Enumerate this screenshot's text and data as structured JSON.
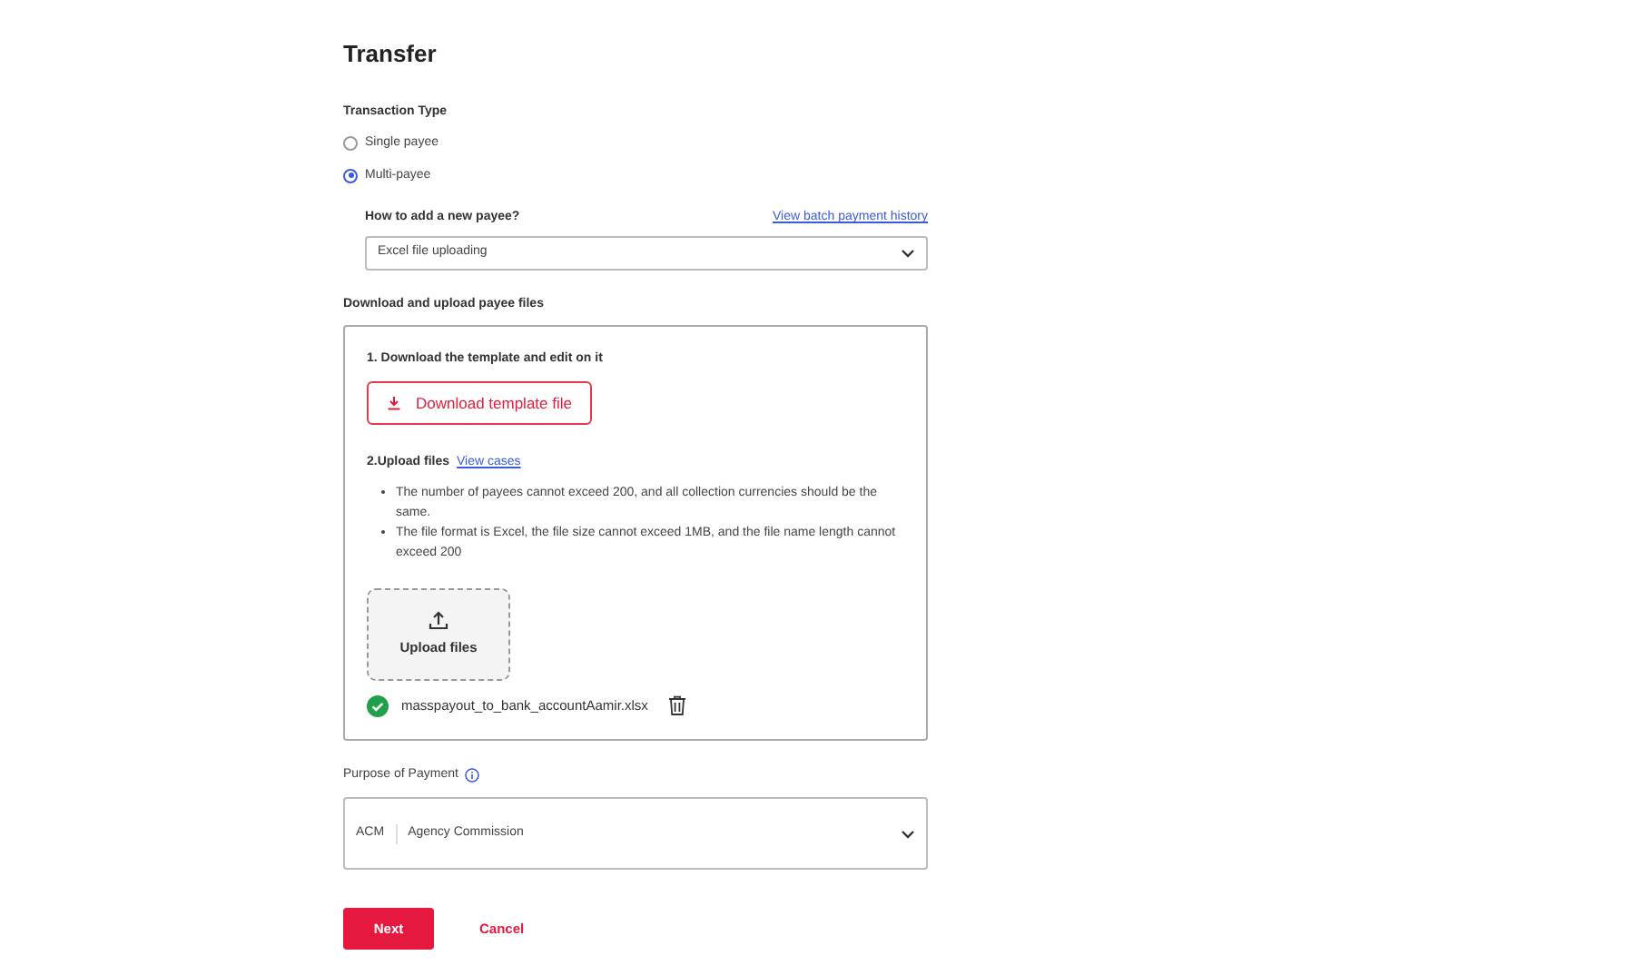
{
  "title": "Transfer",
  "transaction_type": {
    "label": "Transaction Type",
    "options": [
      {
        "label": "Single payee",
        "selected": false
      },
      {
        "label": "Multi-payee",
        "selected": true
      }
    ]
  },
  "add_payee": {
    "label": "How to add a new payee?",
    "link": "View batch payment history",
    "value": "Excel file uploading"
  },
  "upload_section": {
    "label": "Download and upload payee files",
    "step1": "1. Download the template and edit on it",
    "download_button": "Download template file",
    "step2": "2.Upload files",
    "step2_link": "View cases",
    "rules": [
      "The number of payees cannot exceed 200, and all collection currencies should be the same.",
      "The file format is Excel, the file size cannot exceed 1MB, and the file name length cannot exceed 200"
    ],
    "upload_button": "Upload files",
    "file": {
      "name": "masspayout_to_bank_accountAamir.xlsx",
      "uploaded": true
    }
  },
  "purpose": {
    "label": "Purpose of Payment",
    "code": "ACM",
    "value": "Agency Commission"
  },
  "buttons": {
    "next": "Next",
    "cancel": "Cancel"
  }
}
